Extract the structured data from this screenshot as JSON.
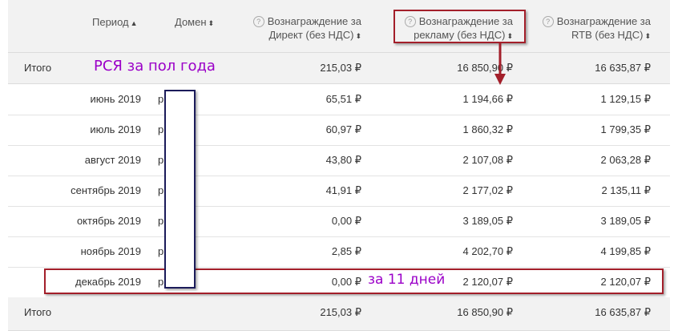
{
  "header": {
    "period": "Период",
    "domain": "Домен",
    "direct_l1": "Вознаграждение за",
    "direct_l2": "Директ (без НДС)",
    "reklama_l1": "Вознаграждение за",
    "reklama_l2": "рекламу (без НДС)",
    "rtb_l1": "Вознаграждение за",
    "rtb_l2": "RTB (без НДС)"
  },
  "total_top": {
    "label": "Итого",
    "direct": "215,03 ₽",
    "reklama": "16 850,90 ₽",
    "rtb": "16 635,87 ₽"
  },
  "rows": [
    {
      "period": "июнь 2019",
      "domain": "p        fo.ru",
      "direct": "65,51 ₽",
      "reklama": "1 194,66 ₽",
      "rtb": "1 129,15 ₽"
    },
    {
      "period": "июль 2019",
      "domain": "p        fo.ru",
      "direct": "60,97 ₽",
      "reklama": "1 860,32 ₽",
      "rtb": "1 799,35 ₽"
    },
    {
      "period": "август 2019",
      "domain": "p        fo.ru",
      "direct": "43,80 ₽",
      "reklama": "2 107,08 ₽",
      "rtb": "2 063,28 ₽"
    },
    {
      "period": "сентябрь 2019",
      "domain": "p        fo.ru",
      "direct": "41,91 ₽",
      "reklama": "2 177,02 ₽",
      "rtb": "2 135,11 ₽"
    },
    {
      "period": "октябрь 2019",
      "domain": "p        fo.ru",
      "direct": "0,00 ₽",
      "reklama": "3 189,05 ₽",
      "rtb": "3 189,05 ₽"
    },
    {
      "period": "ноябрь 2019",
      "domain": "p        fo.ru",
      "direct": "2,85 ₽",
      "reklama": "4 202,70 ₽",
      "rtb": "4 199,85 ₽"
    },
    {
      "period": "декабрь 2019",
      "domain": "p        fo.ru",
      "direct": "0,00 ₽",
      "reklama": "2 120,07 ₽",
      "rtb": "2 120,07 ₽"
    }
  ],
  "total_bottom": {
    "label": "Итого",
    "direct": "215,03 ₽",
    "reklama": "16 850,90 ₽",
    "rtb": "16 635,87 ₽"
  },
  "annotations": {
    "half_year": "РСЯ за пол года",
    "eleven_days": "за 11 дней"
  },
  "colors": {
    "annotation_text": "#9b00c8",
    "annotation_box": "#a31f2a",
    "mask_border": "#1b1b5a"
  }
}
